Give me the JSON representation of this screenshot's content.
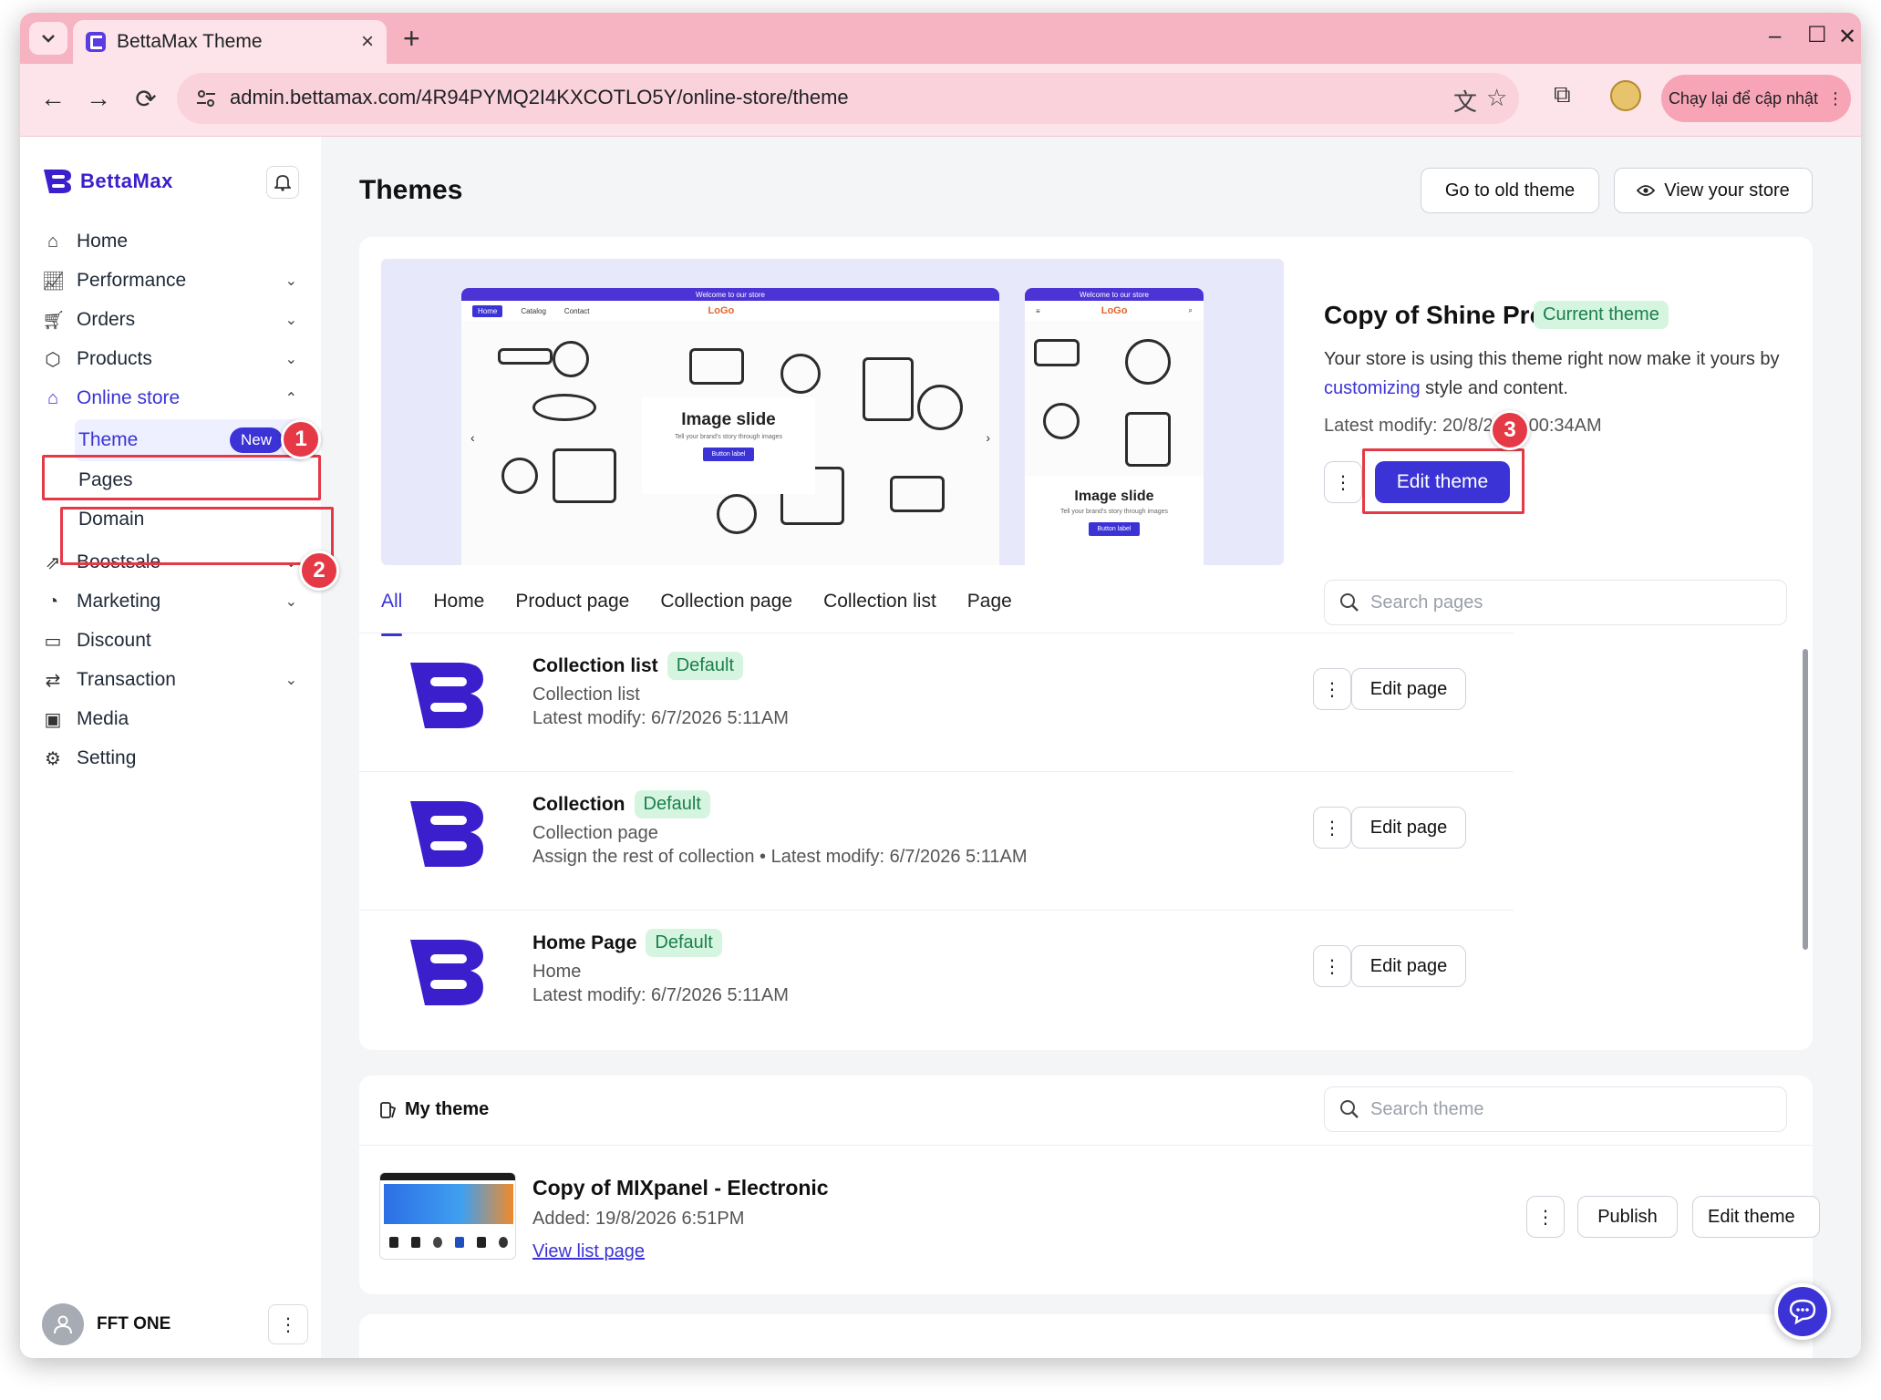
{
  "browser": {
    "tab_title": "BettaMax Theme",
    "url": "admin.bettamax.com/4R94PYMQ2I4KXCOTLO5Y/online-store/theme",
    "update_button": "Chạy lại để cập nhật"
  },
  "sidebar": {
    "logo_text": "BettaMax",
    "items": [
      {
        "label": "Home",
        "icon": "home-icon"
      },
      {
        "label": "Performance",
        "icon": "chart-icon"
      },
      {
        "label": "Orders",
        "icon": "cart-icon"
      },
      {
        "label": "Products",
        "icon": "box-icon"
      },
      {
        "label": "Online store",
        "icon": "store-icon"
      },
      {
        "label": "Boostsale",
        "icon": "boost-icon"
      },
      {
        "label": "Marketing",
        "icon": "marketing-icon"
      },
      {
        "label": "Discount",
        "icon": "ticket-icon"
      },
      {
        "label": "Transaction",
        "icon": "transfer-icon"
      },
      {
        "label": "Media",
        "icon": "media-icon"
      },
      {
        "label": "Setting",
        "icon": "gear-icon"
      }
    ],
    "sub_items": [
      {
        "label": "Theme",
        "badge": "New"
      },
      {
        "label": "Pages"
      },
      {
        "label": "Domain"
      }
    ],
    "user_name": "FFT ONE"
  },
  "steps": [
    "1",
    "2",
    "3"
  ],
  "header": {
    "title": "Themes",
    "old_theme_button": "Go to old theme",
    "view_store_button": "View your store"
  },
  "current_theme": {
    "name": "Copy of Shine Pro",
    "badge": "Current theme",
    "desc_before": "Your store is using this theme right now make it yours by ",
    "desc_link": "customizing",
    "desc_after": " style and content.",
    "modified": "Latest modify: 20/8/2026 00:34AM",
    "edit_button": "Edit theme",
    "preview": {
      "announcement": "Welcome to our store",
      "logo": "LoGo",
      "nav_home": "Home",
      "nav_catalog": "Catalog",
      "nav_contact": "Contact",
      "slide_title": "Image slide",
      "slide_sub": "Tell your brand's story through images",
      "slide_button": "Button label"
    }
  },
  "page_tabs": [
    "All",
    "Home",
    "Product page",
    "Collection page",
    "Collection list",
    "Page"
  ],
  "search_pages_placeholder": "Search pages",
  "pages": [
    {
      "title": "Collection list",
      "badge": "Default",
      "type": "Collection list",
      "detail": "Latest modify: 6/7/2026 5:11AM",
      "action": "Edit page"
    },
    {
      "title": "Collection",
      "badge": "Default",
      "type": "Collection page",
      "detail": "Assign the rest of collection  •  Latest modify: 6/7/2026 5:11AM",
      "action": "Edit page"
    },
    {
      "title": "Home Page",
      "badge": "Default",
      "type": "Home",
      "detail": "Latest modify: 6/7/2026 5:11AM",
      "action": "Edit page"
    }
  ],
  "my_theme": {
    "heading": "My theme",
    "search_placeholder": "Search theme",
    "item": {
      "title": "Copy of MIXpanel - Electronic",
      "added": "Added: 19/8/2026 6:51PM",
      "link": "View list page",
      "publish": "Publish",
      "edit": "Edit theme"
    }
  },
  "colors": {
    "accent": "#3b33d6",
    "highlight": "#e53946",
    "badge_bg": "#d6f5e0",
    "badge_text": "#1a7f4b",
    "tabbar": "#f6b3c1"
  }
}
